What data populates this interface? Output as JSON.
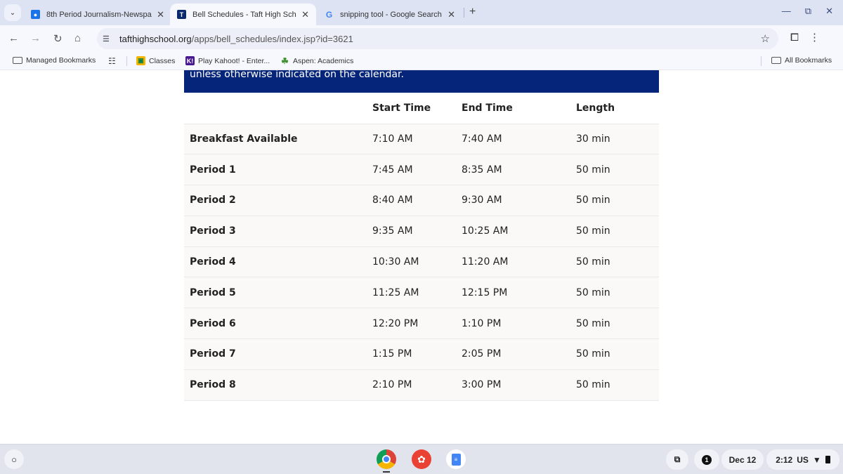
{
  "browser": {
    "tabs": [
      {
        "title": "8th Period Journalism-Newspa",
        "icon": "classroom-icon",
        "active": false
      },
      {
        "title": "Bell Schedules - Taft High Scho",
        "icon": "taft-logo-icon",
        "active": true
      },
      {
        "title": "snipping tool - Google Search",
        "icon": "google-icon",
        "active": false
      }
    ],
    "new_tab": "+",
    "url_host": "tafthighschool.org",
    "url_path": "/apps/bell_schedules/index.jsp?id=3621",
    "bookmarks": [
      {
        "label": "Managed Bookmarks",
        "icon": "managed-folder-icon"
      },
      {
        "label": "Classes",
        "icon": "classroom-icon"
      },
      {
        "label": "Play Kahoot! - Enter...",
        "icon": "kahoot-icon"
      },
      {
        "label": "Aspen: Academics",
        "icon": "aspen-leaf-icon"
      }
    ],
    "all_bookmarks": "All Bookmarks"
  },
  "page": {
    "banner_text": "unless otherwise indicated on the calendar.",
    "table": {
      "headers": [
        "",
        "Start Time",
        "End Time",
        "Length"
      ],
      "rows": [
        {
          "name": "Breakfast Available",
          "start": "7:10 AM",
          "end": "7:40 AM",
          "length": "30 min"
        },
        {
          "name": "Period 1",
          "start": "7:45 AM",
          "end": "8:35 AM",
          "length": "50 min"
        },
        {
          "name": "Period 2",
          "start": "8:40 AM",
          "end": "9:30 AM",
          "length": "50 min"
        },
        {
          "name": "Period 3",
          "start": "9:35 AM",
          "end": "10:25 AM",
          "length": "50 min"
        },
        {
          "name": "Period 4",
          "start": "10:30 AM",
          "end": "11:20 AM",
          "length": "50 min"
        },
        {
          "name": "Period 5",
          "start": "11:25 AM",
          "end": "12:15 PM",
          "length": "50 min"
        },
        {
          "name": "Period 6",
          "start": "12:20 PM",
          "end": "1:10 PM",
          "length": "50 min"
        },
        {
          "name": "Period 7",
          "start": "1:15 PM",
          "end": "2:05 PM",
          "length": "50 min"
        },
        {
          "name": "Period 8",
          "start": "2:10 PM",
          "end": "3:00 PM",
          "length": "50 min"
        }
      ]
    }
  },
  "shelf": {
    "notification_count": "1",
    "date": "Dec 12",
    "time": "2:12",
    "locale": "US"
  },
  "colors": {
    "banner": "#05257a",
    "tabbar": "#dde3f3"
  }
}
